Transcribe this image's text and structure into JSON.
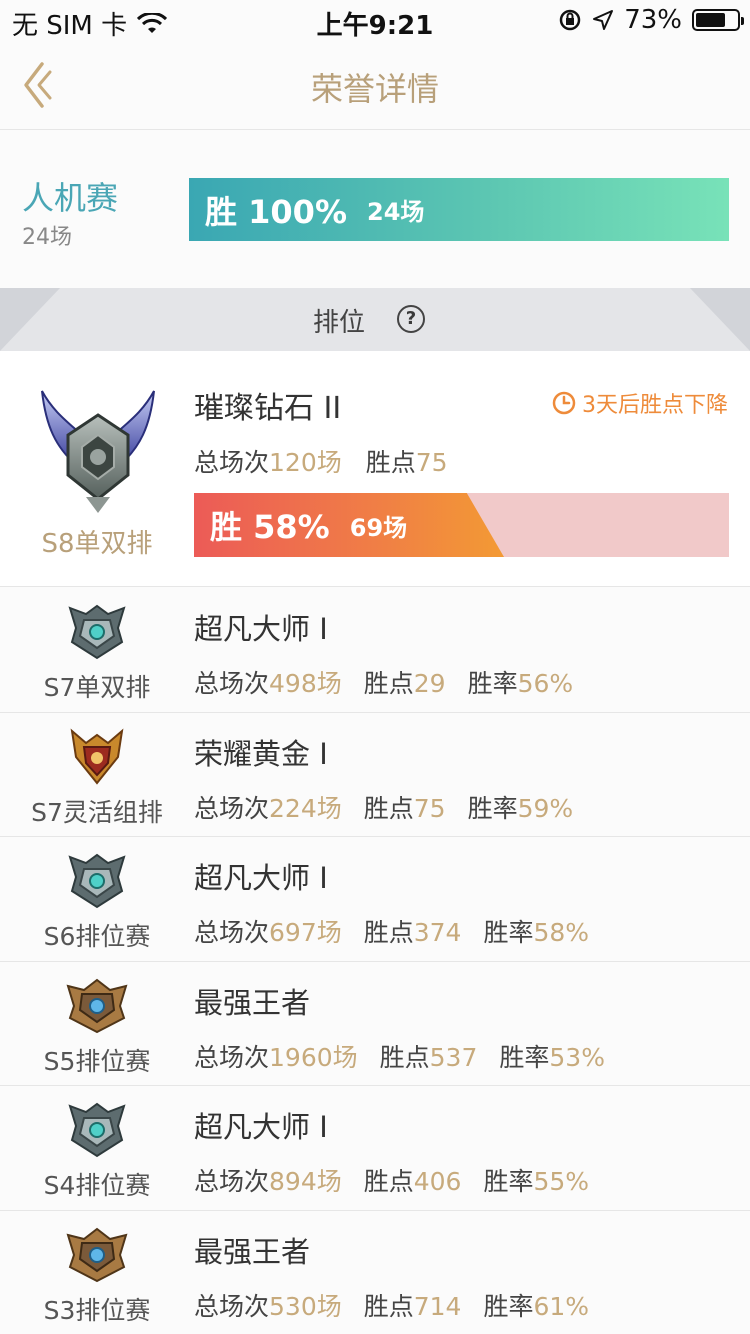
{
  "status_bar": {
    "carrier": "无 SIM 卡",
    "time": "上午9:21",
    "battery": "73%",
    "battery_level": 0.73
  },
  "nav": {
    "title": "荣誉详情"
  },
  "bot_match": {
    "title": "人机赛",
    "count": "24场",
    "bar_win": "胜 100%",
    "bar_count": "24场",
    "win_rate": 1.0
  },
  "ranked": {
    "header": "排位",
    "help_glyph": "?"
  },
  "current_season": {
    "season": "S8单双排",
    "rank": "璀璨钻石 II",
    "warning": "3天后胜点下降",
    "total_label": "总场次",
    "total_value": "120场",
    "points_label": "胜点",
    "points_value": "75",
    "bar_win": "胜 58%",
    "bar_count": "69场",
    "win_rate": 0.58
  },
  "history": [
    {
      "season": "S7单双排",
      "rank": "超凡大师 I",
      "total_label": "总场次",
      "total": "498场",
      "points_label": "胜点",
      "points": "29",
      "rate_label": "胜率",
      "rate": "56%",
      "badge": "master"
    },
    {
      "season": "S7灵活组排",
      "rank": "荣耀黄金 I",
      "total_label": "总场次",
      "total": "224场",
      "points_label": "胜点",
      "points": "75",
      "rate_label": "胜率",
      "rate": "59%",
      "badge": "gold"
    },
    {
      "season": "S6排位赛",
      "rank": "超凡大师 I",
      "total_label": "总场次",
      "total": "697场",
      "points_label": "胜点",
      "points": "374",
      "rate_label": "胜率",
      "rate": "58%",
      "badge": "master"
    },
    {
      "season": "S5排位赛",
      "rank": "最强王者",
      "total_label": "总场次",
      "total": "1960场",
      "points_label": "胜点",
      "points": "537",
      "rate_label": "胜率",
      "rate": "53%",
      "badge": "challenger"
    },
    {
      "season": "S4排位赛",
      "rank": "超凡大师 I",
      "total_label": "总场次",
      "total": "894场",
      "points_label": "胜点",
      "points": "406",
      "rate_label": "胜率",
      "rate": "55%",
      "badge": "master"
    },
    {
      "season": "S3排位赛",
      "rank": "最强王者",
      "total_label": "总场次",
      "total": "530场",
      "points_label": "胜点",
      "points": "714",
      "rate_label": "胜率",
      "rate": "61%",
      "badge": "challenger"
    }
  ],
  "colors": {
    "accent_gold": "#b8a07a",
    "teal": "#4aa6b5",
    "warn_orange": "#ee8b3a"
  }
}
